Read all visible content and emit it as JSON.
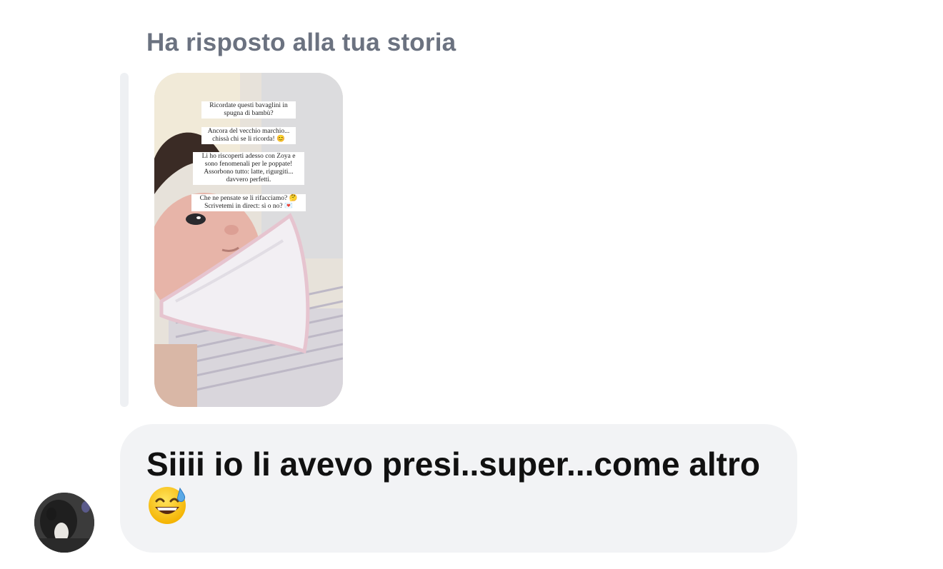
{
  "reply_header": {
    "label": "Ha risposto alla tua storia"
  },
  "story": {
    "captions": [
      "Ricordate questi bavaglini in\nspugna di bambù?",
      "Ancora del vecchio marchio...\nchissà chi se li ricorda! 😊",
      "Li ho riscoperti adesso con Zoya e\nsono fenomenali per le poppate!\nAssorbono tutto: latte, rigurgiti...\ndavvero perfetti.",
      "Che ne pensate se li rifacciamo? 🤔\nScrivetemi in direct: sì o no? 💌"
    ]
  },
  "message": {
    "text": "Siiii io li avevo presi..super...come altro",
    "emoji": "grinning-face-with-sweat-emoji"
  },
  "colors": {
    "bubble": "#f2f3f5",
    "label": "#6b7280",
    "text": "#111111"
  }
}
